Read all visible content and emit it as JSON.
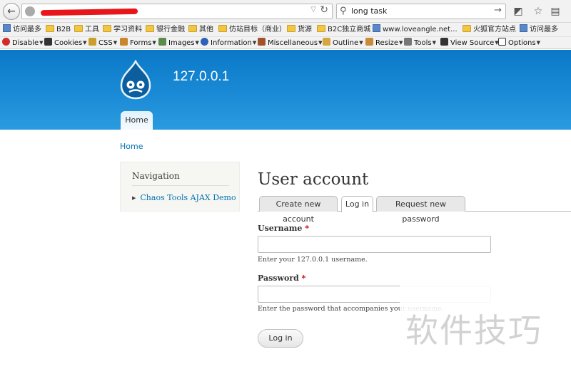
{
  "browser": {
    "search_value": "long task",
    "bookmarks": [
      "访问最多",
      "B2B",
      "工具",
      "学习资料",
      "银行金融",
      "其他",
      "仿站目标（商业）",
      "货源",
      "B2C独立商城",
      "www.loveangle.net...",
      "火狐官方站点",
      "访问最多"
    ],
    "devbar": [
      "Disable",
      "Cookies",
      "CSS",
      "Forms",
      "Images",
      "Information",
      "Miscellaneous",
      "Outline",
      "Resize",
      "Tools",
      "View Source",
      "Options"
    ]
  },
  "site": {
    "name": "127.0.0.1",
    "primary_tab": "Home",
    "brand_color": "#0a78c6"
  },
  "breadcrumb": "Home",
  "sidebar": {
    "title": "Navigation",
    "link": "Chaos Tools AJAX Demo"
  },
  "main": {
    "title": "User account",
    "tabs": [
      "Create new account",
      "Log in",
      "Request new password"
    ],
    "active_tab": "Log in",
    "username_label": "Username",
    "username_desc": "Enter your 127.0.0.1 username.",
    "password_label": "Password",
    "password_desc": "Enter the password that accompanies your username.",
    "required_mark": "*",
    "submit_label": "Log in"
  },
  "watermark": "软件技巧"
}
